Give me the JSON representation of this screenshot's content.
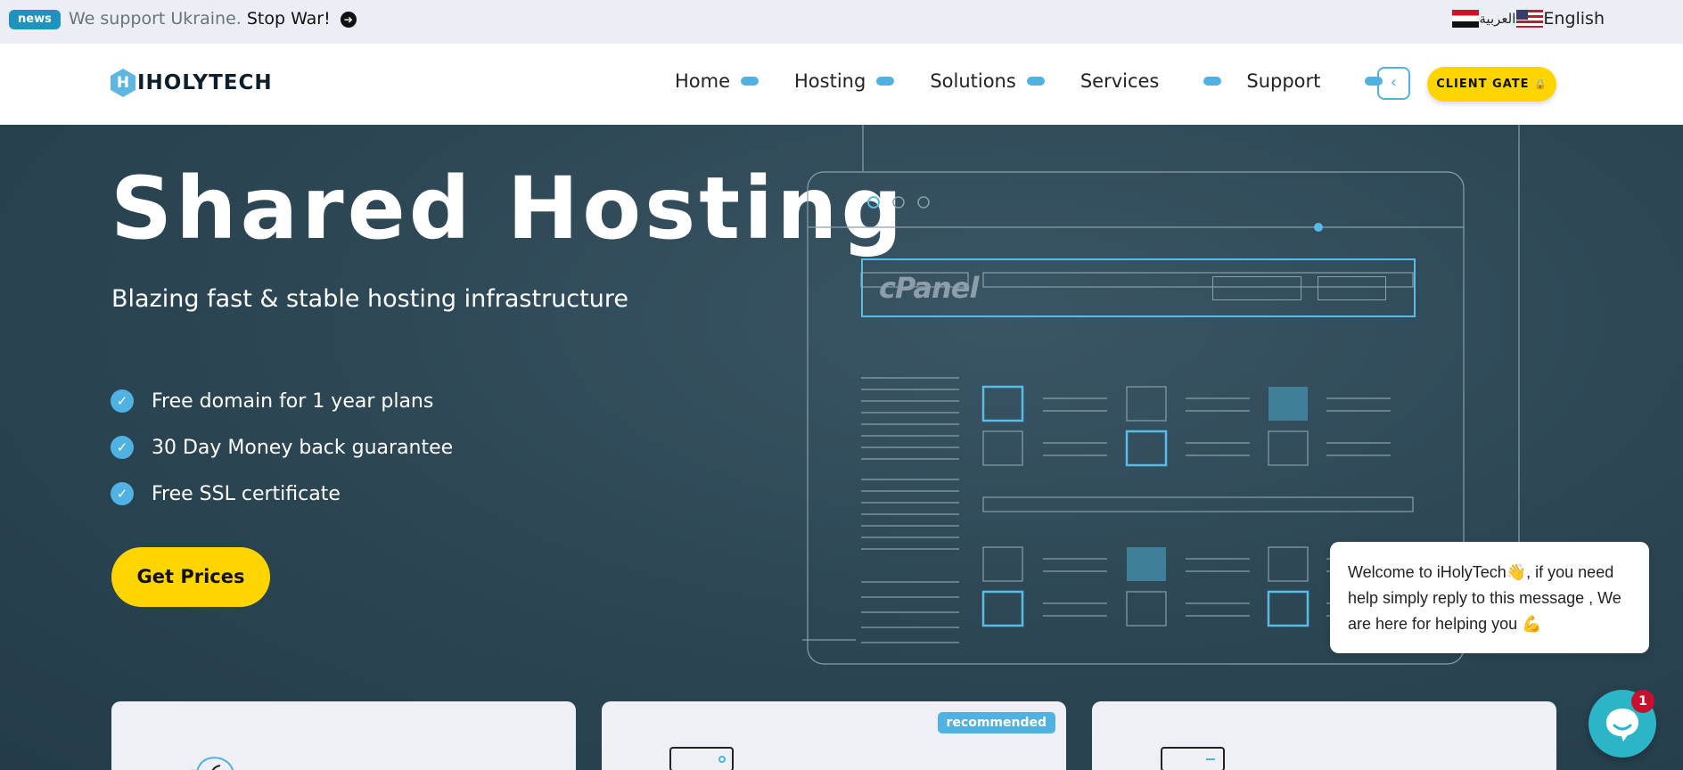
{
  "newsbar": {
    "badge": "news",
    "message": "We support Ukraine.",
    "link": "Stop War!",
    "arrow_icon": "arrow-right-circle-icon"
  },
  "language": {
    "arabic": "العربية",
    "english": "English"
  },
  "header": {
    "logo_text": "IHOLYTECH",
    "nav": [
      {
        "label": "Home"
      },
      {
        "label": "Hosting"
      },
      {
        "label": "Solutions"
      },
      {
        "label": "Services"
      },
      {
        "label": "Support"
      }
    ],
    "toggle_icon": "‹",
    "client_gate": "CLIENT GATE",
    "lock_icon": "🔒"
  },
  "hero": {
    "title": "Shared Hosting",
    "subtitle": "Blazing fast & stable hosting infrastructure",
    "features": [
      "Free domain for 1 year plans",
      "30 Day Money back guarantee",
      "Free SSL certificate"
    ],
    "cta": "Get Prices",
    "illustration_brand": "cPanel"
  },
  "cards": {
    "recommended": "recommended"
  },
  "chat": {
    "line1": "Welcome to iHolyTech👋, if you need",
    "line2": "help simply reply to this message , We",
    "line3": "are here for helping you 💪",
    "unread_count": "1"
  },
  "colors": {
    "accent": "#4fb2e3",
    "cta": "#ffd500",
    "hero_bg": "#2b4553",
    "news_badge": "#1f93bd"
  }
}
